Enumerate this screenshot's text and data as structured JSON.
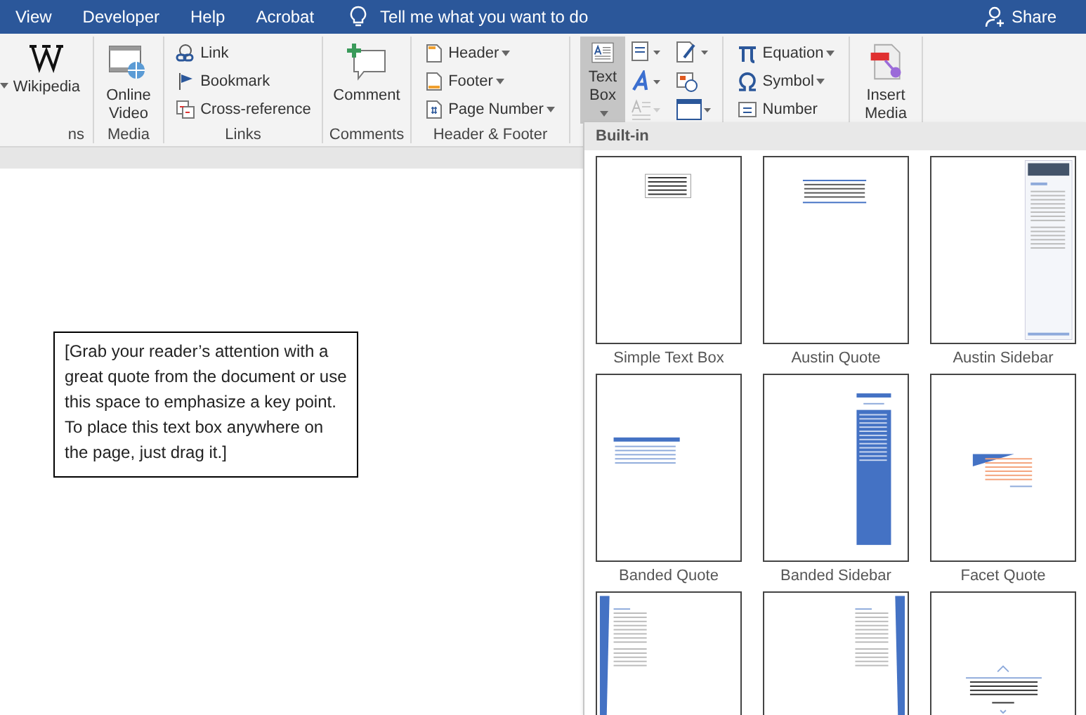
{
  "menu_tabs": [
    {
      "label": "View"
    },
    {
      "label": "Developer"
    },
    {
      "label": "Help"
    },
    {
      "label": "Acrobat"
    }
  ],
  "tell_me": "Tell me what you want to do",
  "share": "Share",
  "ribbon": {
    "groups": [
      {
        "label": "ns",
        "items": [
          {
            "kind": "large",
            "label": "Wikipedia"
          }
        ]
      },
      {
        "label": "Media",
        "items": [
          {
            "kind": "large",
            "label": "Online Video"
          }
        ]
      },
      {
        "label": "Links",
        "items": [
          {
            "kind": "small",
            "label": "Link"
          },
          {
            "kind": "small",
            "label": "Bookmark"
          },
          {
            "kind": "small",
            "label": "Cross-reference"
          }
        ]
      },
      {
        "label": "Comments",
        "items": [
          {
            "kind": "large",
            "label": "Comment"
          }
        ]
      },
      {
        "label": "Header & Footer",
        "items": [
          {
            "kind": "small",
            "label": "Header",
            "dropdown": true
          },
          {
            "kind": "small",
            "label": "Footer",
            "dropdown": true
          },
          {
            "kind": "small",
            "label": "Page Number",
            "dropdown": true
          }
        ]
      },
      {
        "items": [
          {
            "kind": "large",
            "label": "Text Box",
            "dropdown": true,
            "selected": true
          }
        ]
      },
      {
        "items": [
          {
            "kind": "small",
            "label": "Equation",
            "dropdown": true
          },
          {
            "kind": "small",
            "label": "Symbol",
            "dropdown": true
          },
          {
            "kind": "small",
            "label": "Number"
          }
        ]
      },
      {
        "items": [
          {
            "kind": "large",
            "label": "Insert Media"
          }
        ]
      }
    ]
  },
  "document": {
    "text_box": "[Grab your reader’s attention with a great quote from the document or use this space to emphasize a key point. To place this text box anywhere on the page, just drag it.]"
  },
  "gallery": {
    "header": "Built-in",
    "items": [
      {
        "kind": "simple",
        "label": "Simple Text Box"
      },
      {
        "kind": "quote",
        "label": "Austin Quote"
      },
      {
        "kind": "sidebar",
        "label": "Austin Sidebar"
      },
      {
        "kind": "banded-quote",
        "label": "Banded Quote"
      },
      {
        "kind": "banded-sidebar",
        "label": "Banded Sidebar"
      },
      {
        "kind": "facet-quote",
        "label": "Facet Quote"
      },
      {
        "kind": "left-bar"
      },
      {
        "kind": "right-bar"
      },
      {
        "kind": "centered"
      }
    ]
  }
}
